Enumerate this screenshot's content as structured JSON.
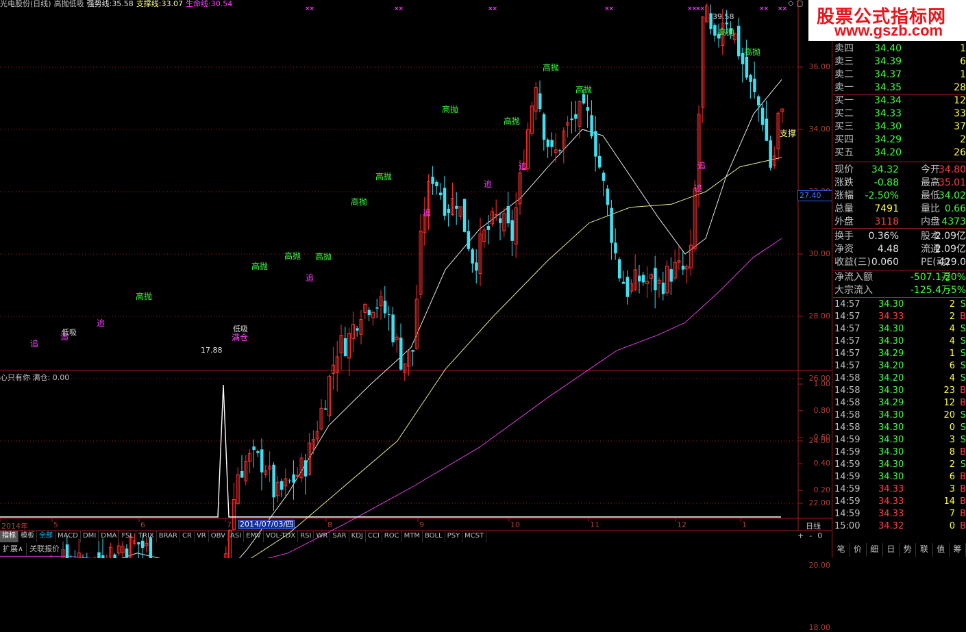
{
  "header": {
    "name": "光电股份(日线)",
    "formula": "高抛低吸",
    "line1_label": "强势线:",
    "line1_value": "35.58",
    "line2_label": "支撑线:",
    "line2_value": "33.07",
    "line3_label": "生命线:",
    "line3_value": "30.54"
  },
  "indicator_header": {
    "name": "心只有你",
    "label": "满仓:",
    "value": "0.00"
  },
  "y_ticks_main": [
    "36.00",
    "34.00",
    "32.00",
    "30.00",
    "28.00",
    "26.00",
    "24.00",
    "22.00",
    "20.00",
    "18.00"
  ],
  "y_ticks_ind": [
    "1.00",
    "0.80",
    "0.60",
    "0.40",
    "0.20"
  ],
  "price_box": "27.40",
  "x_labels": [
    {
      "label": "2014年"
    },
    {
      "label": "5"
    },
    {
      "label": "6"
    },
    {
      "label": "7"
    },
    {
      "label": "8"
    },
    {
      "label": "9"
    },
    {
      "label": "10"
    },
    {
      "label": "11"
    },
    {
      "label": "12"
    },
    {
      "label": "1"
    }
  ],
  "x_selected": "2014/07/03/四",
  "period_label": "日线",
  "signals": {
    "high_sell": "高抛",
    "chase": "追",
    "low_buy": "低吸",
    "full": "满仓",
    "support": "支撑",
    "xx": "××"
  },
  "price_marks": {
    "high": "39.58",
    "low": "17.88"
  },
  "tabs": [
    "指标",
    "模板",
    "全部",
    "MACD",
    "DMI",
    "DMA",
    "FSL",
    "TRIX",
    "BRAR",
    "CR",
    "VR",
    "OBV",
    "ASI",
    "EMV",
    "VOL-TDX",
    "RSI",
    "WR",
    "SAR",
    "KDJ",
    "CCI",
    "ROC",
    "MTM",
    "BOLL",
    "PSY",
    "MCST"
  ],
  "tab_controls": [
    "+",
    "-",
    "0"
  ],
  "bottom_left": [
    "扩展∧",
    "关联报价"
  ],
  "brand": {
    "line1": "股票公式指标网",
    "line2": "www.gszb.com"
  },
  "order_book": [
    {
      "label": "卖四",
      "price": "34.40",
      "vol": "1"
    },
    {
      "label": "卖三",
      "price": "34.39",
      "vol": "6"
    },
    {
      "label": "卖二",
      "price": "34.37",
      "vol": "1"
    },
    {
      "label": "卖一",
      "price": "34.35",
      "vol": "28"
    },
    {
      "label": "买一",
      "price": "34.34",
      "vol": "12"
    },
    {
      "label": "买二",
      "price": "34.33",
      "vol": "33"
    },
    {
      "label": "买三",
      "price": "34.30",
      "vol": "37"
    },
    {
      "label": "买四",
      "price": "34.29",
      "vol": "2"
    },
    {
      "label": "买五",
      "price": "34.20",
      "vol": "26"
    }
  ],
  "quote": [
    {
      "k1": "现价",
      "v1": "34.32",
      "k2": "今开",
      "v2": "34.80",
      "c1": "green",
      "c2": "red"
    },
    {
      "k1": "涨跌",
      "v1": "-0.88",
      "k2": "最高",
      "v2": "35.01",
      "c1": "green",
      "c2": "red"
    },
    {
      "k1": "涨幅",
      "v1": "-2.50%",
      "k2": "最低",
      "v2": "34.02",
      "c1": "green",
      "c2": "green"
    },
    {
      "k1": "总量",
      "v1": "7491",
      "k2": "量比",
      "v2": "0.66",
      "c1": "yellow",
      "c2": "green"
    },
    {
      "k1": "外盘",
      "v1": "3118",
      "k2": "内盘",
      "v2": "4373",
      "c1": "red",
      "c2": "green"
    }
  ],
  "fund": [
    {
      "k1": "换手",
      "v1": "0.36%",
      "k2": "股本",
      "v2": "2.09亿"
    },
    {
      "k1": "净资",
      "v1": "4.48",
      "k2": "流通",
      "v2": "2.09亿"
    },
    {
      "k1": "收益(三)",
      "v1": "0.060",
      "k2": "PE(动)",
      "v2": "429.0"
    }
  ],
  "flow": [
    {
      "k": "净流入额",
      "v": "-507.1万",
      "p": "-20%"
    },
    {
      "k": "大宗流入",
      "v": "-125.4万",
      "p": "-5%"
    }
  ],
  "ticks": [
    {
      "t": "14:57",
      "p": "34.30",
      "v": "2",
      "s": "S"
    },
    {
      "t": "14:57",
      "p": "34.33",
      "v": "2",
      "s": "B"
    },
    {
      "t": "14:57",
      "p": "34.30",
      "v": "4",
      "s": "S"
    },
    {
      "t": "14:57",
      "p": "34.30",
      "v": "4",
      "s": "S"
    },
    {
      "t": "14:57",
      "p": "34.29",
      "v": "1",
      "s": "S"
    },
    {
      "t": "14:57",
      "p": "34.20",
      "v": "6",
      "s": "S"
    },
    {
      "t": "14:58",
      "p": "34.20",
      "v": "4",
      "s": "S"
    },
    {
      "t": "14:58",
      "p": "34.30",
      "v": "23",
      "s": "B"
    },
    {
      "t": "14:58",
      "p": "34.29",
      "v": "12",
      "s": "B"
    },
    {
      "t": "14:58",
      "p": "34.30",
      "v": "20",
      "s": "S"
    },
    {
      "t": "14:58",
      "p": "34.30",
      "v": "0",
      "s": "S"
    },
    {
      "t": "14:59",
      "p": "34.30",
      "v": "3",
      "s": "S"
    },
    {
      "t": "14:59",
      "p": "34.30",
      "v": "8",
      "s": "B"
    },
    {
      "t": "14:59",
      "p": "34.30",
      "v": "2",
      "s": "S"
    },
    {
      "t": "14:59",
      "p": "34.30",
      "v": "6",
      "s": "B"
    },
    {
      "t": "14:59",
      "p": "34.33",
      "v": "3",
      "s": "B"
    },
    {
      "t": "14:59",
      "p": "34.33",
      "v": "14",
      "s": "B"
    },
    {
      "t": "14:59",
      "p": "34.33",
      "v": "7",
      "s": "B"
    },
    {
      "t": "15:00",
      "p": "34.32",
      "v": "0",
      "s": "B"
    }
  ],
  "nav": [
    "笔",
    "价",
    "细",
    "日",
    "势",
    "联",
    "值",
    "筹"
  ],
  "colors": {
    "up": "#ff3030",
    "down": "#40e0f0",
    "ma_white": "#e8e8e8",
    "ma_yellow": "#e8e890",
    "ma_magenta": "#e040e0",
    "grid": "#a02020"
  }
}
